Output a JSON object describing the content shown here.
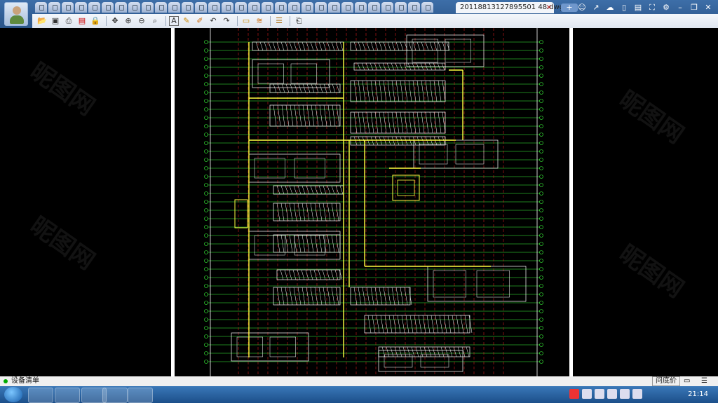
{
  "window": {
    "document_tab": "20118813127895501 48.dwg",
    "document_tab_close": "×",
    "new_tab": "+"
  },
  "toolbar": {
    "text_tool": "A"
  },
  "status": {
    "device_list": "设备清单",
    "ask_price": "问底价"
  },
  "taskbar": {
    "clock": "21:14"
  },
  "colors": {
    "title_bar": "#2a5488",
    "canvas": "#000000",
    "cad_green": "#3cff3c",
    "cad_red": "#ff2020",
    "cad_yellow": "#ffff40",
    "cad_white": "#ffffff"
  },
  "icons": [
    "user-avatar-icon",
    "open-icon",
    "save-icon",
    "print-icon",
    "pdf-icon",
    "lock-icon",
    "pan-icon",
    "zoom-in-icon",
    "zoom-out-icon",
    "zoom-window-icon",
    "text-icon",
    "pencil-icon",
    "highlighter-icon",
    "undo-icon",
    "redo-icon",
    "layer-icon",
    "measure-icon",
    "layers-stack-icon",
    "export-icon"
  ]
}
